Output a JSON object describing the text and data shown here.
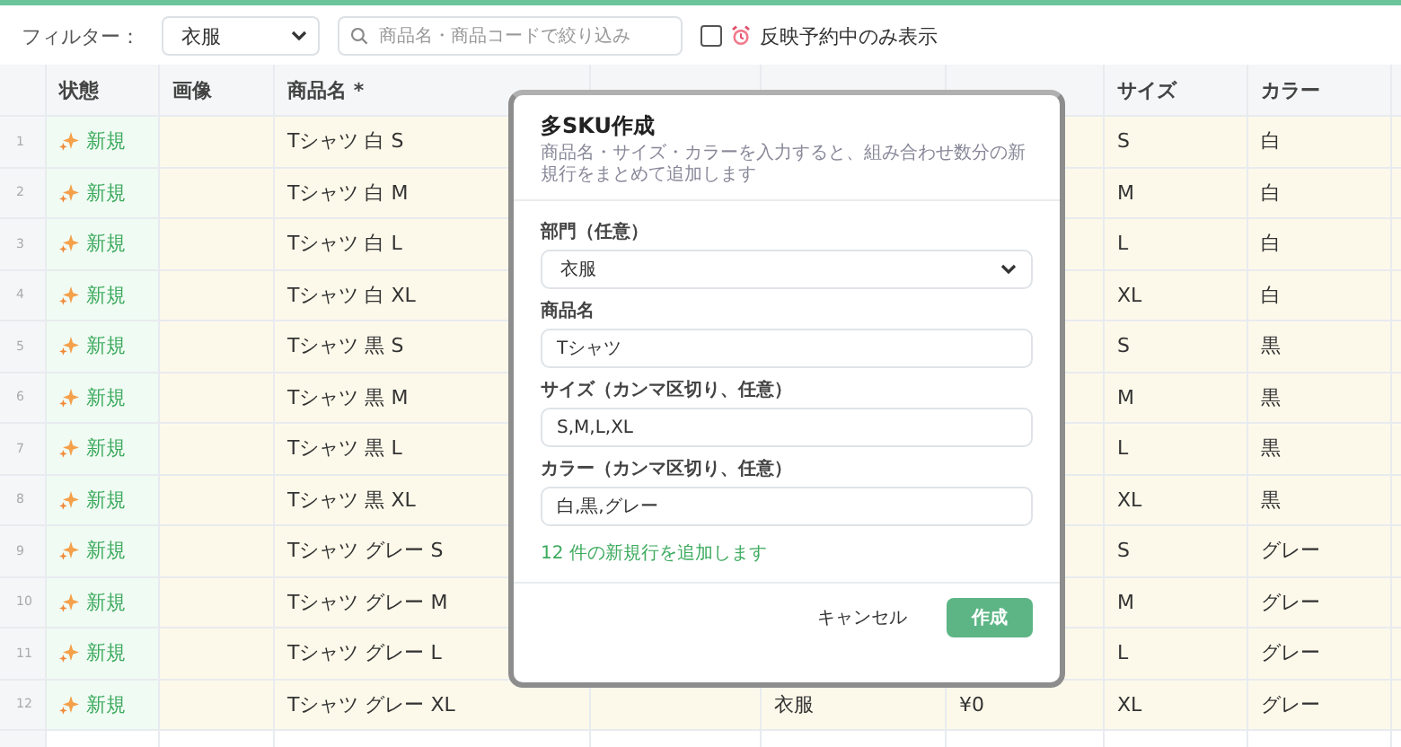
{
  "filter": {
    "label": "フィルター：",
    "category": "衣服",
    "search_placeholder": "商品名・商品コードで絞り込み",
    "pending_only": {
      "label": "反映予約中のみ表示",
      "checked": false
    }
  },
  "table": {
    "columns_left": [
      "状態",
      "画像",
      "商品名 *"
    ],
    "columns_right": [
      "サイズ",
      "カラー"
    ],
    "rows": [
      {
        "number": "1",
        "status": "新規",
        "name": "Tシャツ 白 S",
        "size": "S",
        "color_name": "白"
      },
      {
        "number": "2",
        "status": "新規",
        "name": "Tシャツ 白 M",
        "size": "M",
        "color_name": "白"
      },
      {
        "number": "3",
        "status": "新規",
        "name": "Tシャツ 白 L",
        "size": "L",
        "color_name": "白"
      },
      {
        "number": "4",
        "status": "新規",
        "name": "Tシャツ 白 XL",
        "size": "XL",
        "color_name": "白"
      },
      {
        "number": "5",
        "status": "新規",
        "name": "Tシャツ 黒 S",
        "size": "S",
        "color_name": "黒"
      },
      {
        "number": "6",
        "status": "新規",
        "name": "Tシャツ 黒 M",
        "size": "M",
        "color_name": "黒"
      },
      {
        "number": "7",
        "status": "新規",
        "name": "Tシャツ 黒 L",
        "size": "L",
        "color_name": "黒"
      },
      {
        "number": "8",
        "status": "新規",
        "name": "Tシャツ 黒 XL",
        "size": "XL",
        "color_name": "黒"
      },
      {
        "number": "9",
        "status": "新規",
        "name": "Tシャツ グレー S",
        "size": "S",
        "color_name": "グレー"
      },
      {
        "number": "10",
        "status": "新規",
        "name": "Tシャツ グレー M",
        "size": "M",
        "color_name": "グレー"
      },
      {
        "number": "11",
        "status": "新規",
        "name": "Tシャツ グレー L",
        "size": "L",
        "color_name": "グレー"
      },
      {
        "number": "12",
        "status": "新規",
        "name": "Tシャツ グレー XL",
        "department": "衣服",
        "price": "¥0",
        "size": "XL",
        "color_name": "グレー"
      }
    ]
  },
  "dialog": {
    "title": "多SKU作成",
    "description": "商品名・サイズ・カラーを入力すると、組み合わせ数分の新規行をまとめて追加します",
    "fields": [
      {
        "label": "部門（任意）",
        "kind": "select",
        "value": "衣服"
      },
      {
        "label": "商品名",
        "kind": "text",
        "value": "Tシャツ"
      },
      {
        "label": "サイズ（カンマ区切り、任意）",
        "kind": "text",
        "value": "S,M,L,XL"
      },
      {
        "label": "カラー（カンマ区切り、任意）",
        "kind": "text",
        "value": "白,黒,グレー"
      }
    ],
    "summary": "12 件の新規行を追加します",
    "buttons": [
      {
        "label": "キャンセル",
        "kind": "secondary"
      },
      {
        "label": "作成",
        "kind": "primary"
      }
    ]
  }
}
